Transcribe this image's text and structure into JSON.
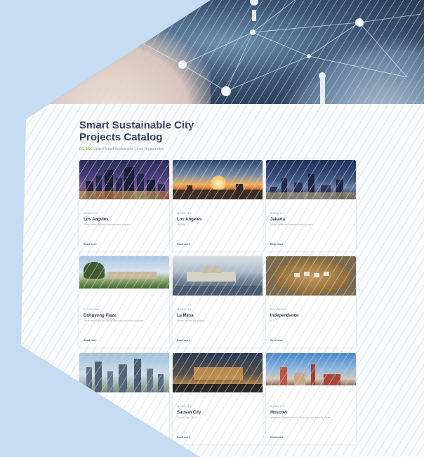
{
  "catalog": {
    "title_line1": "Smart Sustainable City",
    "title_line2": "Projects Catalog",
    "subtitle_tag": "FG-SSC",
    "subtitle_text": "United Smart Sustainable Cities Organization"
  },
  "projects": [
    {
      "category": "MOBILITY",
      "name": "Los Angeles",
      "description": "Smart street lighting management system",
      "more": "Read more"
    },
    {
      "category": "MOBILITY",
      "name": "Los Angeles",
      "description": "Mobility",
      "more": "Read more"
    },
    {
      "category": "MOBILITY",
      "name": "Jakarta",
      "description": "Smart traffic and transportation project",
      "more": "Read more"
    },
    {
      "category": "ECONOMY",
      "name": "Dubuyong Plaza",
      "description": "Smart economy for SMEs and local business platform",
      "more": "Read more"
    },
    {
      "category": "MOBILITY",
      "name": "La Mesa",
      "description": "Smart vibrant city project",
      "more": "Read more"
    },
    {
      "category": "ECONOMY",
      "name": "Independence",
      "description": "ICT",
      "more": "Read more"
    },
    {
      "category": "MOBILITY",
      "name": "Sausan City",
      "description": "Virtual City CBFS",
      "more": "Read more"
    },
    {
      "category": "MOBILITY",
      "name": "Moscow",
      "description": "Integrated Platform of the Moscow and Intercity Smart",
      "more": "Read more"
    }
  ],
  "colors": {
    "background": "#c5dcf2",
    "title": "#2f3a5c",
    "accent_green": "#7bbf3a"
  },
  "icons": [
    "network-node-icon",
    "location-pin-icon"
  ]
}
